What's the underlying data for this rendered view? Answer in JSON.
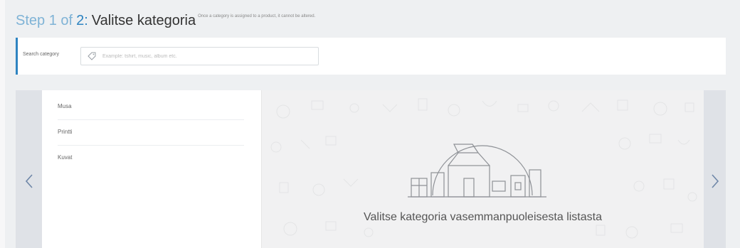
{
  "header": {
    "step_prefix": "Step 1 of",
    "step_number": "2",
    "step_colon": ":",
    "title": "Valitse kategoria",
    "note": "Once a category is assigned to a product, it cannot be altered."
  },
  "search": {
    "label": "Search category",
    "placeholder": "Example: tshirt, music, album etc."
  },
  "categories": [
    {
      "label": "Musa"
    },
    {
      "label": "Printti"
    },
    {
      "label": "Kuvat"
    }
  ],
  "empty_state": {
    "message": "Valitse kategoria vasemmanpuoleisesta listasta"
  },
  "colors": {
    "accent": "#2e84c1",
    "accent_light": "#7fb3d6",
    "background": "#eef0f2"
  },
  "icons": {
    "search": "tag-icon",
    "prev": "chevron-left-icon",
    "next": "chevron-right-icon"
  }
}
